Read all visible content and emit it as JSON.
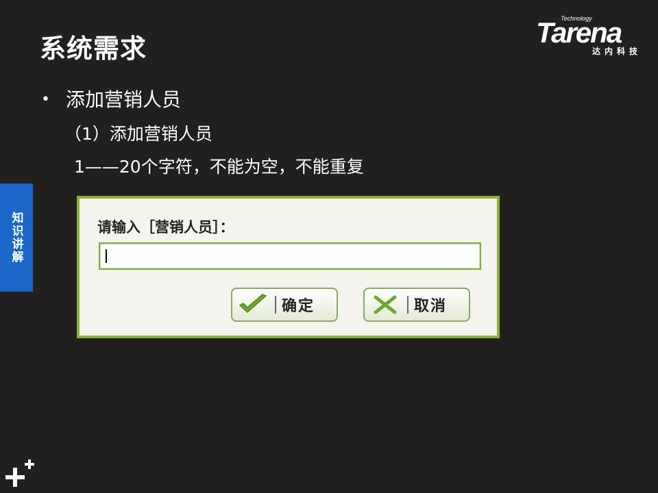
{
  "slide": {
    "title": "系统需求",
    "bullet": "添加营销人员",
    "sub1": "（1）添加营销人员",
    "sub2": "1——20个字符，不能为空，不能重复"
  },
  "logo": {
    "small": "Technology",
    "word": "Tarena",
    "cn": "达内科技"
  },
  "side_tab": {
    "label": "知识讲解"
  },
  "dialog": {
    "prompt": "请输入［营销人员］：",
    "input_value": "",
    "ok_label": "确定",
    "cancel_label": "取消"
  },
  "colors": {
    "background": "#221f1f",
    "side_tab": "#1a67c7",
    "dialog_border": "#8bb338",
    "ok_icon": "#6aa92c",
    "cancel_icon": "#6aa92c"
  },
  "icons": {
    "ok": "checkmark-icon",
    "cancel": "x-icon",
    "corner": "plus-plus-icon"
  }
}
